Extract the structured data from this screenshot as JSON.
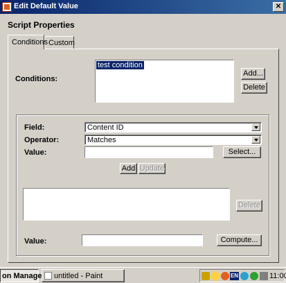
{
  "window": {
    "title": "Edit Default Value"
  },
  "section_title": "Script Properties",
  "tabs": [
    {
      "label": "Conditions",
      "active": true
    },
    {
      "label": "Custom",
      "active": false
    }
  ],
  "conditions": {
    "label": "Conditions:",
    "items": [
      "test condition"
    ],
    "add_label": "Add...",
    "delete_label": "Delete"
  },
  "editor": {
    "field_label": "Field:",
    "field_value": "Content ID",
    "operator_label": "Operator:",
    "operator_value": "Matches",
    "value_label": "Value:",
    "value_input": "",
    "select_label": "Select...",
    "add_label": "Add",
    "update_label": "Update",
    "delete_label": "Delete"
  },
  "footer": {
    "value_label": "Value:",
    "value_input": "",
    "compute_label": "Compute..."
  },
  "taskbar": {
    "item1": "on Manage...",
    "item2": "untitled - Paint",
    "tray_en": "EN",
    "clock": "11:00"
  }
}
